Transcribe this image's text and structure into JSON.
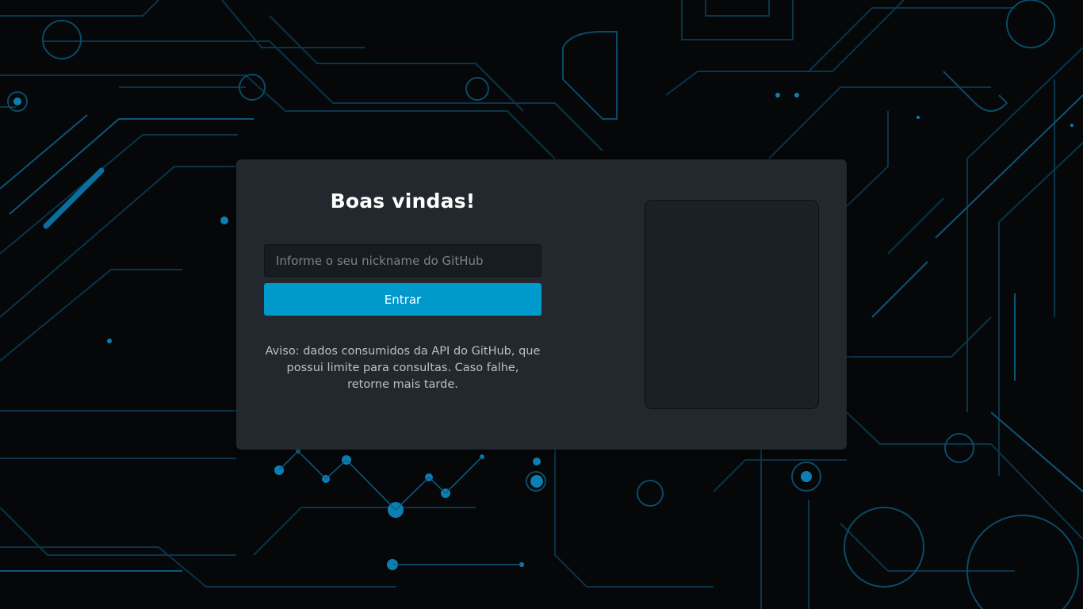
{
  "login": {
    "title": "Boas vindas!",
    "nickname_placeholder": "Informe o seu nickname do GitHub",
    "nickname_value": "",
    "submit_label": "Entrar",
    "notice": "Aviso: dados consumidos da API do GitHub, que possui limite para consultas. Caso falhe, retorne mais tarde."
  },
  "colors": {
    "background": "#050708",
    "card": "#22282e",
    "accent": "#0099cc",
    "circuit": "#0b6e99"
  }
}
